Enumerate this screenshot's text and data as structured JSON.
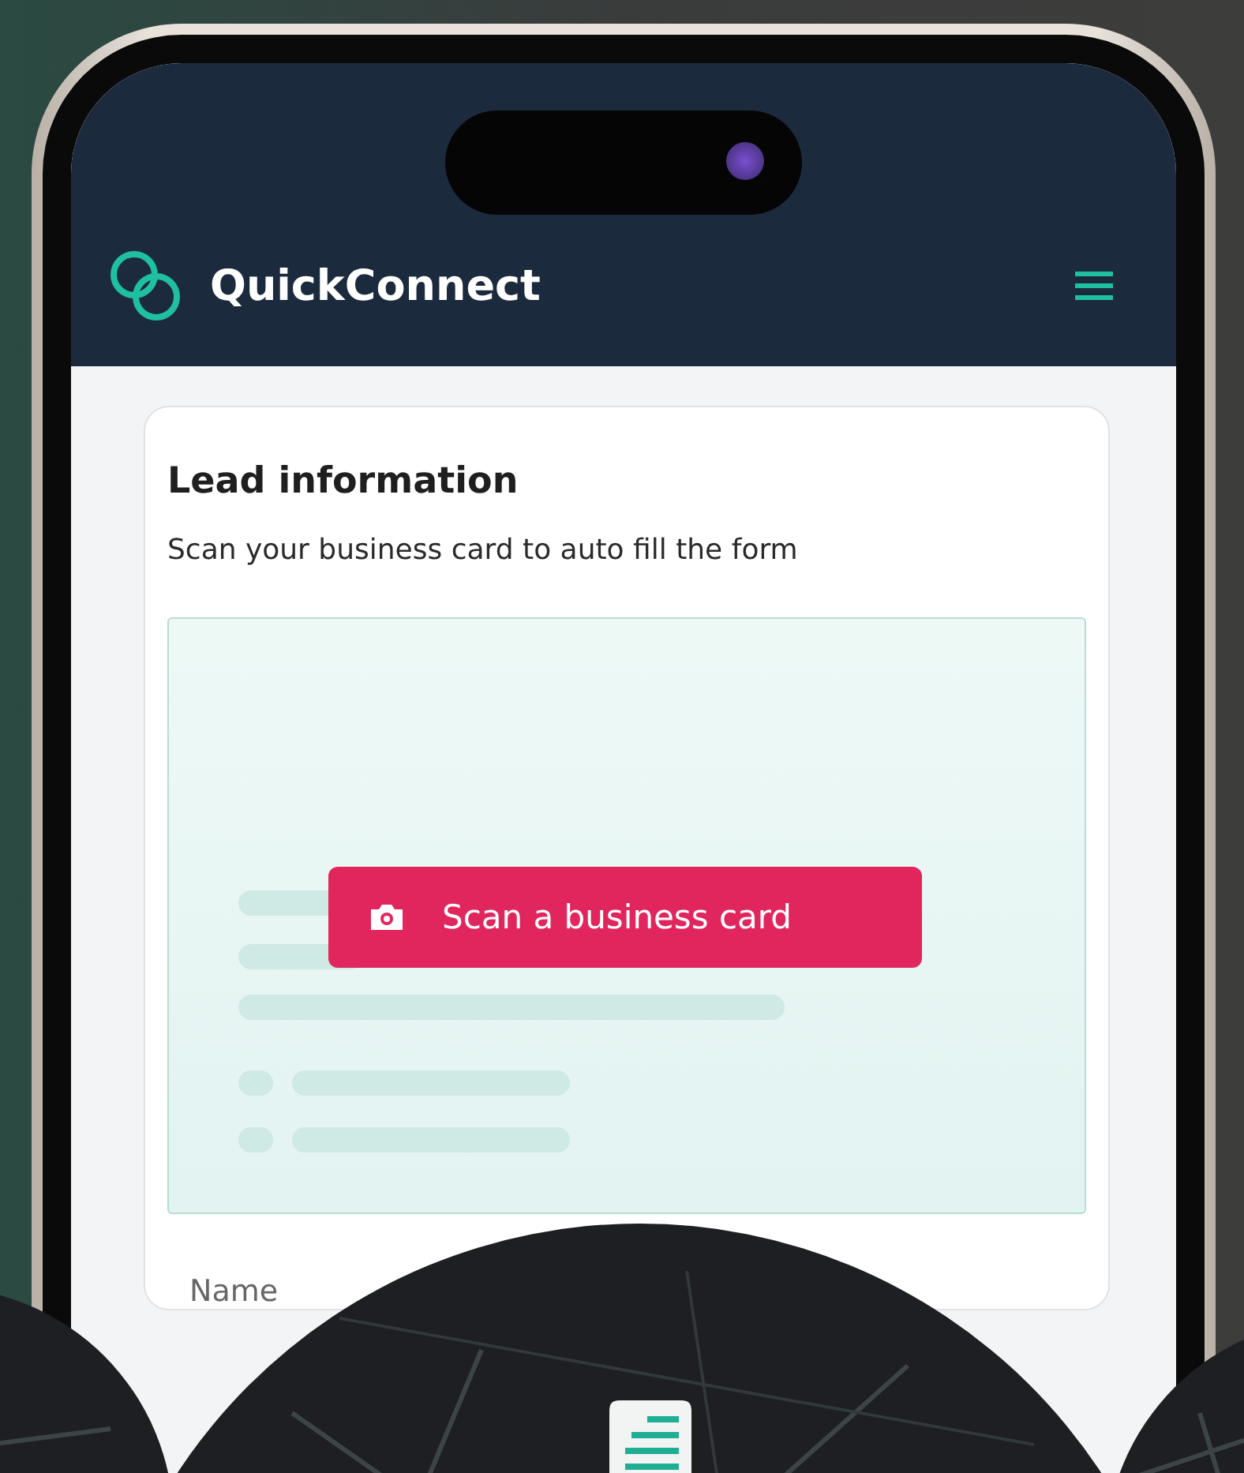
{
  "app": {
    "name": "QuickConnect"
  },
  "card": {
    "title": "Lead information",
    "subtitle": "Scan your business card to auto fill the form",
    "scan_button": "Scan a business card"
  },
  "form": {
    "fields": [
      {
        "label": "Name"
      }
    ]
  }
}
